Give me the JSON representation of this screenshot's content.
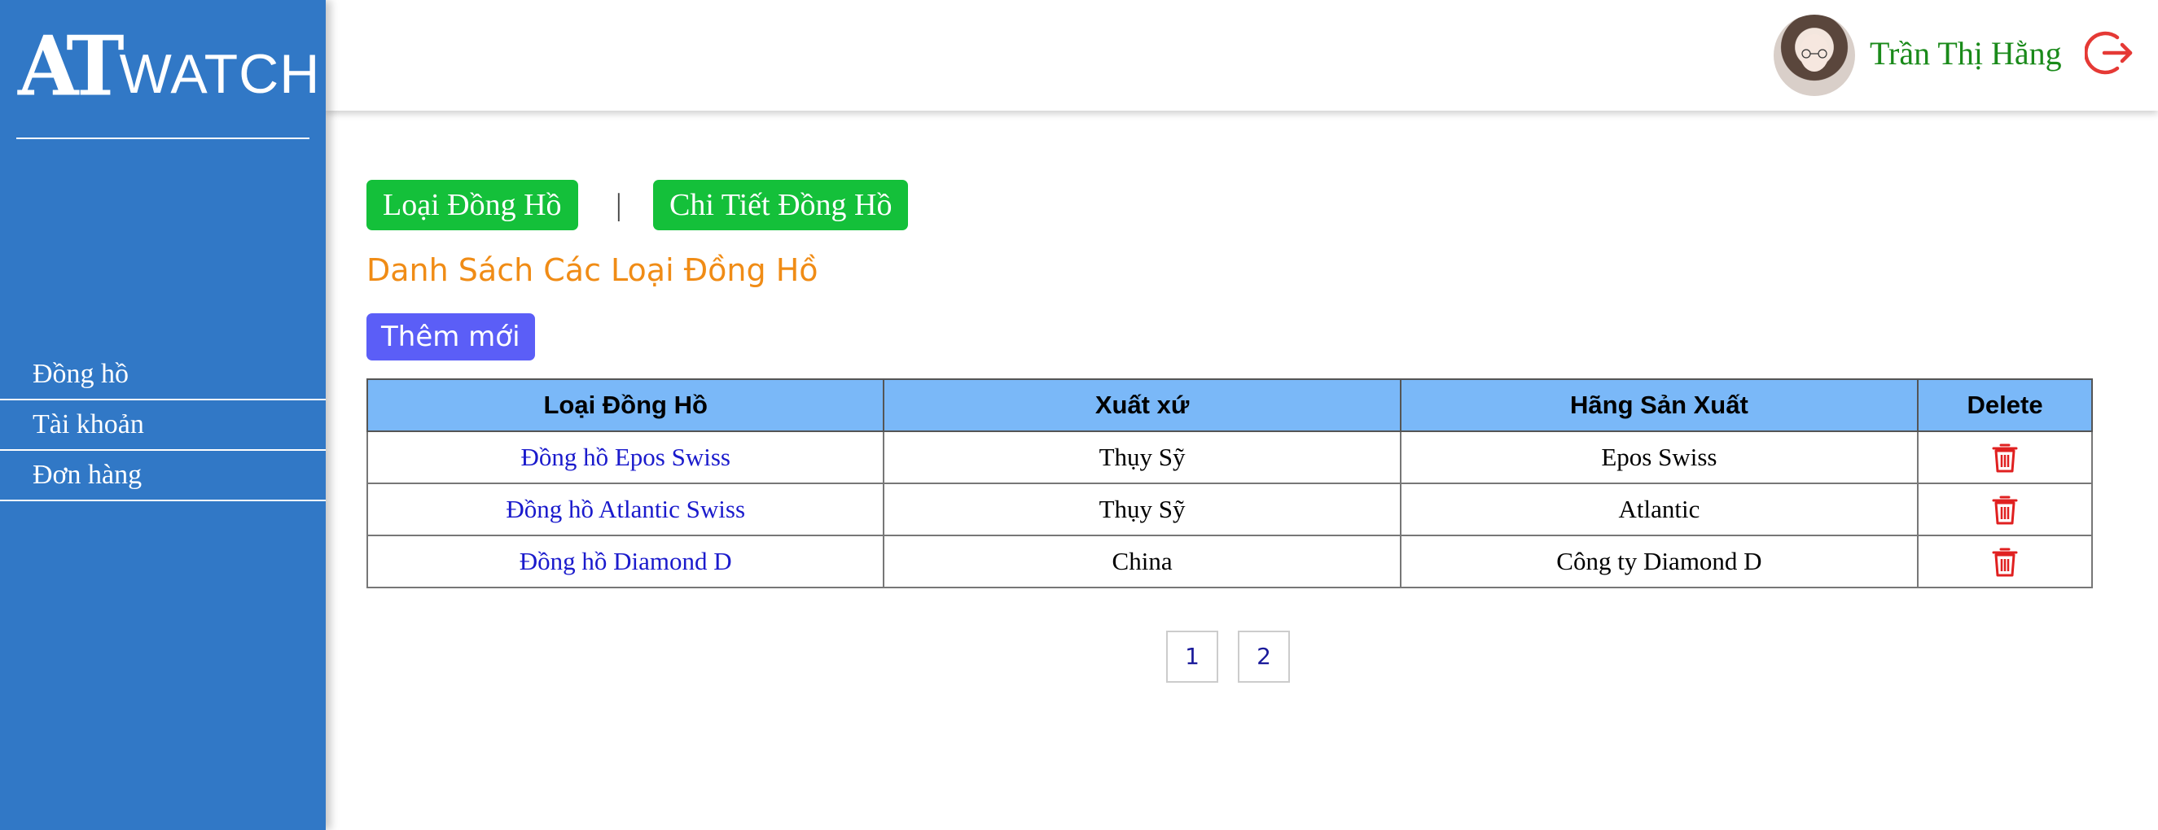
{
  "brand": {
    "logo_mark": "AT",
    "logo_text": "WATCH"
  },
  "sidebar": {
    "items": [
      {
        "label": "Đồng hồ"
      },
      {
        "label": "Tài khoản"
      },
      {
        "label": "Đơn hàng"
      }
    ]
  },
  "header": {
    "username": "Trần Thị Hằng",
    "logout_icon": "logout-icon"
  },
  "tabs": {
    "watch_types": "Loại Đồng Hồ",
    "separator": "|",
    "watch_details": "Chi Tiết Đồng Hồ"
  },
  "main": {
    "heading": "Danh Sách Các Loại Đồng Hồ",
    "add_button": "Thêm mới"
  },
  "table": {
    "headers": [
      "Loại Đồng Hồ",
      "Xuất xứ",
      "Hãng Sản Xuất",
      "Delete"
    ],
    "rows": [
      {
        "type": "Đồng hồ Epos Swiss",
        "origin": "Thụy Sỹ",
        "maker": "Epos Swiss"
      },
      {
        "type": "Đồng hồ Atlantic Swiss",
        "origin": "Thụy Sỹ",
        "maker": "Atlantic"
      },
      {
        "type": "Đồng hồ Diamond D",
        "origin": "China",
        "maker": "Công ty Diamond D"
      }
    ]
  },
  "pagination": {
    "pages": [
      "1",
      "2"
    ]
  },
  "colors": {
    "sidebar": "#3178c6",
    "tab_button": "#14c03a",
    "heading": "#f08c16",
    "add_button": "#5b5ef7",
    "table_header": "#7ab8f8",
    "link": "#1a1acc",
    "delete": "#e02020",
    "username": "#1a8a1a"
  }
}
